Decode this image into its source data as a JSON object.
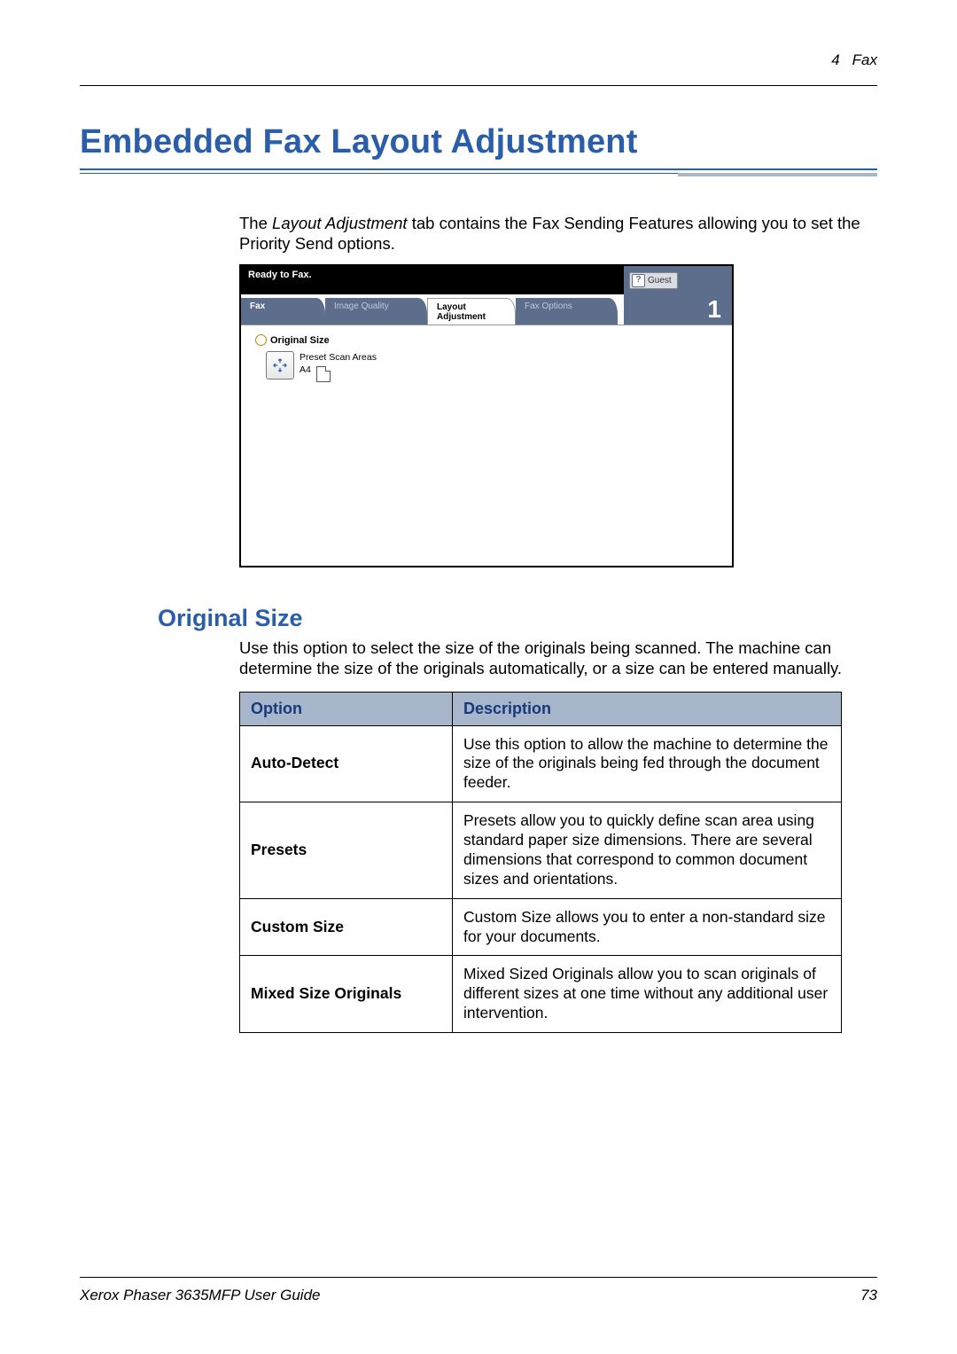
{
  "header": {
    "chapter_num": "4",
    "chapter_name": "Fax"
  },
  "title": "Embedded Fax Layout Adjustment",
  "intro_before_em": "The ",
  "intro_em": "Layout Adjustment",
  "intro_after_em": " tab contains the Fax Sending Features allowing you to set the Priority Send options.",
  "device": {
    "status": "Ready to Fax.",
    "guest": "Guest",
    "tabs": [
      "Fax",
      "Image Quality",
      "Layout Adjustment",
      "Fax Options"
    ],
    "count": "1",
    "orig_label": "Original Size",
    "preset_l1": "Preset Scan Areas",
    "preset_l2": "A4"
  },
  "section_title": "Original Size",
  "section_text": "Use this option to select the size of the originals being scanned. The machine can determine the size of the originals automatically, or a size can be entered manually.",
  "table": {
    "h1": "Option",
    "h2": "Description",
    "rows": [
      {
        "opt": "Auto-Detect",
        "desc": "Use this option to allow the machine to determine the size of the originals being fed through the document feeder."
      },
      {
        "opt": "Presets",
        "desc": "Presets allow you to quickly define scan area using standard paper size dimensions. There are several dimensions that correspond to common document sizes and orientations."
      },
      {
        "opt": "Custom Size",
        "desc": "Custom Size allows you to enter a non-standard size for your documents."
      },
      {
        "opt": "Mixed Size Originals",
        "desc": "Mixed Sized Originals allow you to scan originals of different sizes at one time without any additional user intervention."
      }
    ]
  },
  "footer": {
    "left": "Xerox Phaser 3635MFP User Guide",
    "right": "73"
  }
}
